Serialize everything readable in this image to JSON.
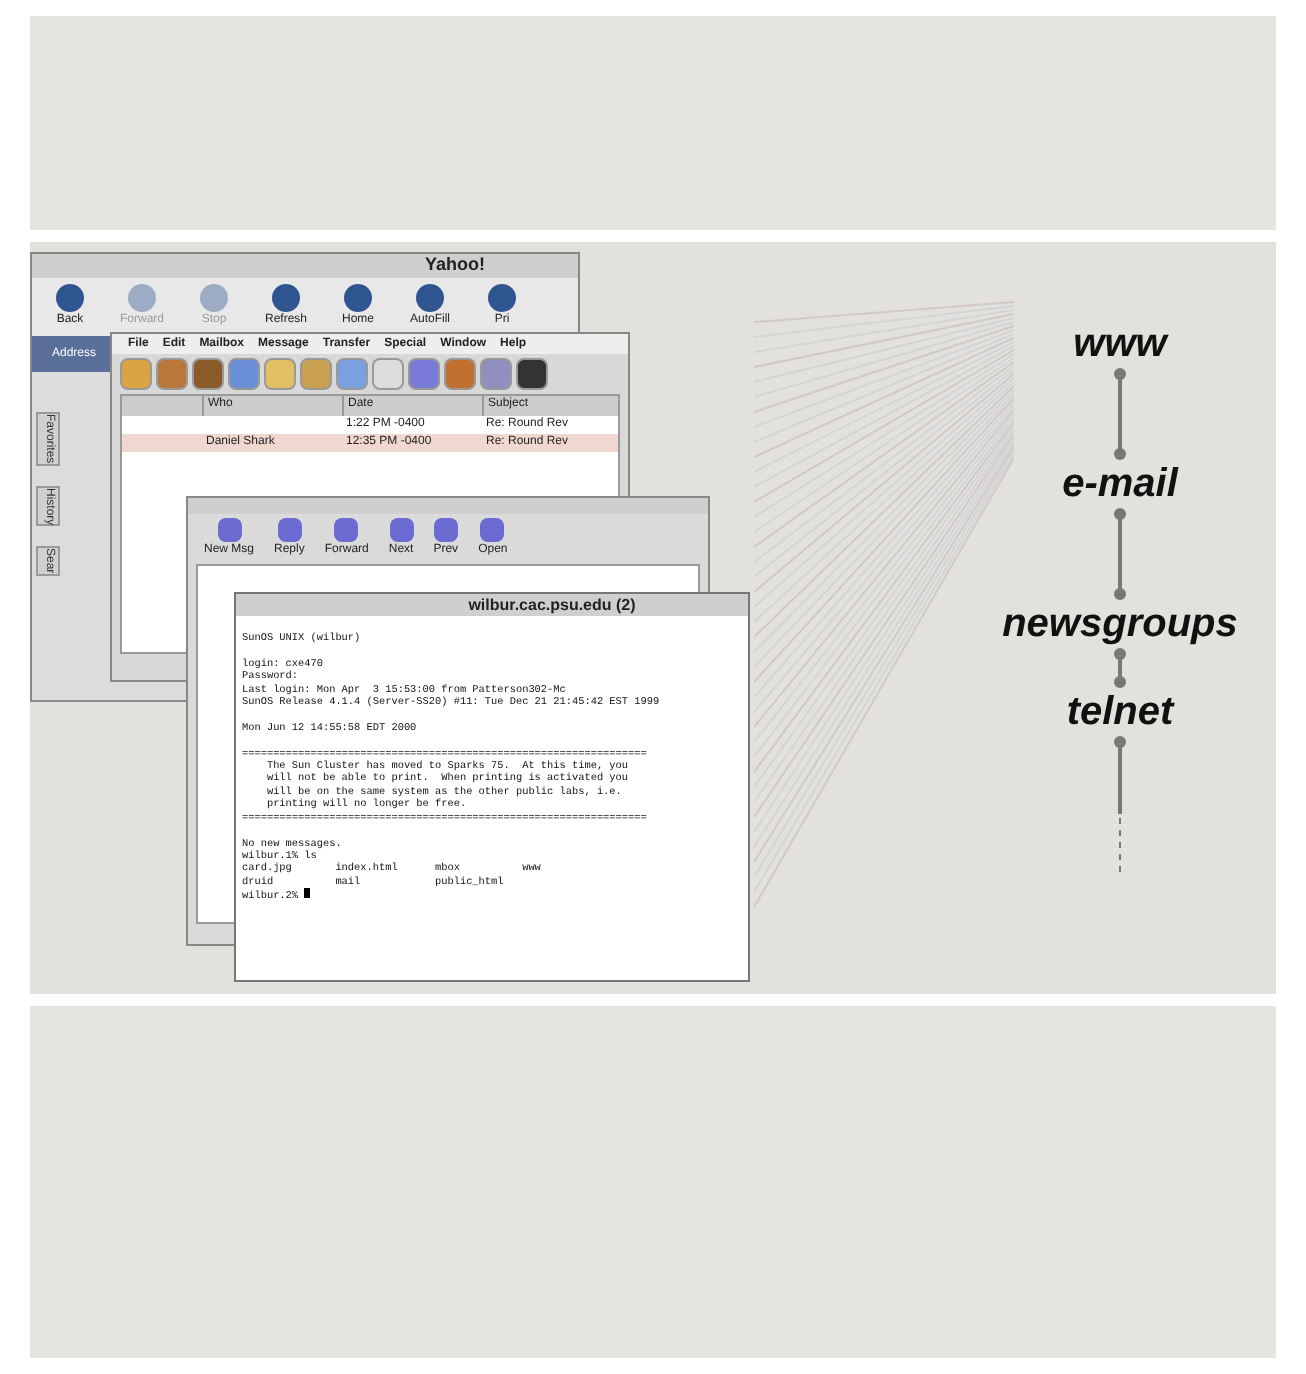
{
  "browser_window": {
    "title": "Yahoo!",
    "toolbar": [
      {
        "label": "Back",
        "disabled": false
      },
      {
        "label": "Forward",
        "disabled": true
      },
      {
        "label": "Stop",
        "disabled": true
      },
      {
        "label": "Refresh",
        "disabled": false
      },
      {
        "label": "Home",
        "disabled": false
      },
      {
        "label": "AutoFill",
        "disabled": false
      },
      {
        "label": "Pri",
        "disabled": false
      }
    ],
    "address_label": "Address",
    "side_tabs": [
      "Favorites",
      "History",
      "Sear"
    ]
  },
  "mail_app": {
    "menu": [
      "File",
      "Edit",
      "Mailbox",
      "Message",
      "Transfer",
      "Special",
      "Window",
      "Help"
    ],
    "mailbox": {
      "columns": [
        "Who",
        "Date",
        "Subject"
      ],
      "rows": [
        {
          "date": "1:22 PM -0400",
          "subject": "Re: Round Rev",
          "selected": false
        },
        {
          "who": "Daniel Shark",
          "date": "12:35 PM -0400",
          "subject": "Re: Round Rev",
          "selected": true
        }
      ]
    }
  },
  "newsgroup_window": {
    "toolbar": [
      "New Msg",
      "Reply",
      "Forward",
      "Next",
      "Prev",
      "Open"
    ]
  },
  "terminal": {
    "title": "wilbur.cac.psu.edu (2)",
    "blocks": [
      [
        "SunOS UNIX (wilbur)"
      ],
      [
        "login: cxe470",
        "Password:",
        "Last login: Mon Apr  3 15:53:00 from Patterson302-Mc",
        "SunOS Release 4.1.4 (Server-SS20) #11: Tue Dec 21 21:45:42 EST 1999"
      ],
      [
        "Mon Jun 12 14:55:58 EDT 2000"
      ],
      [
        "=================================================================",
        "    The Sun Cluster has moved to Sparks 75.  At this time, you",
        "    will not be able to print.  When printing is activated you",
        "    will be on the same system as the other public labs, i.e.",
        "    printing will no longer be free.",
        "================================================================="
      ],
      [
        "No new messages.",
        "wilbur.1% ls",
        "card.jpg       index.html      mbox          www",
        "druid          mail            public_html",
        "wilbur.2% "
      ]
    ]
  },
  "timeline": {
    "items": [
      "www",
      "e-mail",
      "newsgroups",
      "telnet"
    ]
  }
}
